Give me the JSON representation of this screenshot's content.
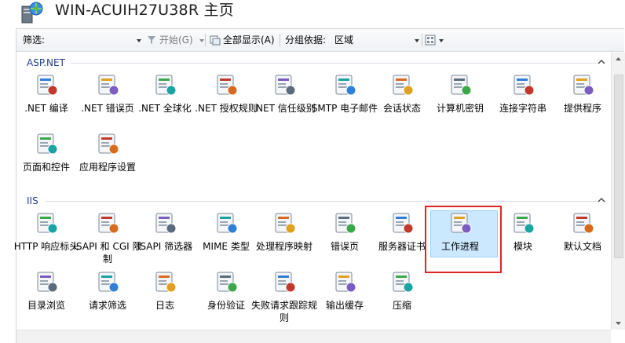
{
  "window": {
    "title": "WIN-ACUIH27U38R 主页"
  },
  "filter_bar": {
    "filter_label": "筛选:",
    "filter_value": "",
    "go_label": "开始(G)",
    "show_all_label": "全部显示(A)",
    "group_by_label": "分组依据:",
    "group_by_value": "区域"
  },
  "groups": [
    {
      "title": "ASP.NET",
      "features": [
        {
          "label": ".NET 编译",
          "icon": "dotnet-compilation-icon"
        },
        {
          "label": ".NET 错误页",
          "icon": "dotnet-error-pages-icon"
        },
        {
          "label": ".NET 全球化",
          "icon": "dotnet-globalization-icon"
        },
        {
          "label": ".NET 授权规则",
          "icon": "dotnet-authorization-rules-icon"
        },
        {
          "label": ".NET 信任级别",
          "icon": "dotnet-trust-levels-icon"
        },
        {
          "label": "SMTP 电子邮件",
          "icon": "smtp-email-icon"
        },
        {
          "label": "会话状态",
          "icon": "session-state-icon"
        },
        {
          "label": "计算机密钥",
          "icon": "machine-key-icon"
        },
        {
          "label": "连接字符串",
          "icon": "connection-strings-icon"
        },
        {
          "label": "提供程序",
          "icon": "providers-icon"
        },
        {
          "label": "页面和控件",
          "icon": "pages-controls-icon"
        },
        {
          "label": "应用程序设置",
          "icon": "application-settings-icon"
        }
      ]
    },
    {
      "title": "IIS",
      "features": [
        {
          "label": "HTTP 响应标头",
          "icon": "http-response-headers-icon"
        },
        {
          "label": "ISAPI 和 CGI 限制",
          "icon": "isapi-cgi-restrictions-icon"
        },
        {
          "label": "ISAPI 筛选器",
          "icon": "isapi-filters-icon"
        },
        {
          "label": "MIME 类型",
          "icon": "mime-types-icon"
        },
        {
          "label": "处理程序映射",
          "icon": "handler-mappings-icon"
        },
        {
          "label": "错误页",
          "icon": "error-pages-icon"
        },
        {
          "label": "服务器证书",
          "icon": "server-certificates-icon"
        },
        {
          "label": "工作进程",
          "icon": "worker-processes-icon",
          "selected": true
        },
        {
          "label": "模块",
          "icon": "modules-icon"
        },
        {
          "label": "默认文档",
          "icon": "default-document-icon"
        },
        {
          "label": "目录浏览",
          "icon": "directory-browsing-icon"
        },
        {
          "label": "请求筛选",
          "icon": "request-filtering-icon"
        },
        {
          "label": "日志",
          "icon": "logging-icon"
        },
        {
          "label": "身份验证",
          "icon": "authentication-icon"
        },
        {
          "label": "失败请求跟踪规则",
          "icon": "failed-request-tracing-icon"
        },
        {
          "label": "输出缓存",
          "icon": "output-caching-icon"
        },
        {
          "label": "压缩",
          "icon": "compression-icon"
        }
      ]
    }
  ]
}
